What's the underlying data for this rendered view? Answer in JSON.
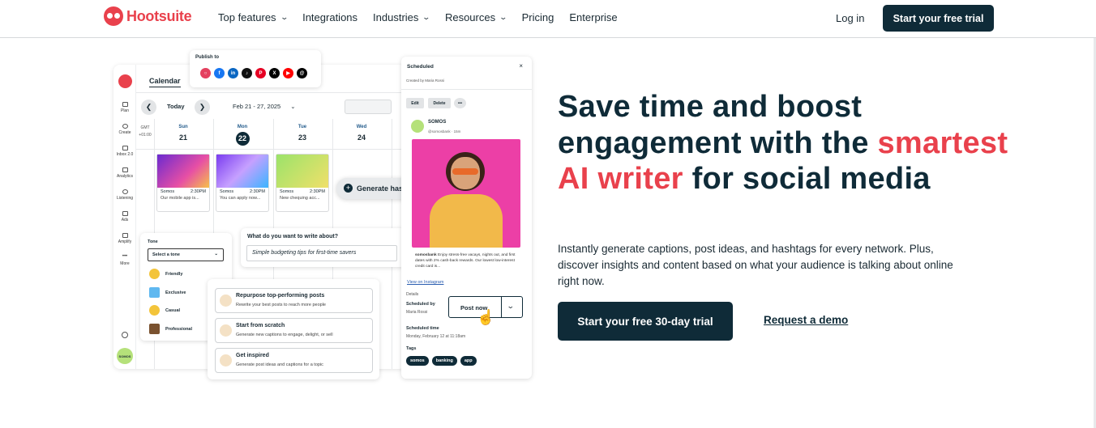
{
  "nav": {
    "logo_text": "Hootsuite",
    "items": [
      {
        "label": "Top features",
        "dropdown": true
      },
      {
        "label": "Integrations",
        "dropdown": false
      },
      {
        "label": "Industries",
        "dropdown": true
      },
      {
        "label": "Resources",
        "dropdown": true
      },
      {
        "label": "Pricing",
        "dropdown": false
      },
      {
        "label": "Enterprise",
        "dropdown": false
      }
    ],
    "login": "Log in",
    "cta": "Start your free trial"
  },
  "hero": {
    "headline_pre": "Save time and boost engagement with the ",
    "headline_highlight": "smartest AI writer",
    "headline_post": " for social media",
    "subtext": "Instantly generate captions, post ideas, and hashtags for every network. Plus, discover insights and content based on what your audience is talking about online right now.",
    "cta": "Start your free 30-day trial",
    "secondary": "Request a demo"
  },
  "mockup": {
    "calendar_title": "Calendar",
    "today": "Today",
    "date_range": "Feb 21 - 27, 2025",
    "tz": "GMT +01:00",
    "days": [
      {
        "name": "Sun",
        "num": "21"
      },
      {
        "name": "Mon",
        "num": "22"
      },
      {
        "name": "Tue",
        "num": "23"
      },
      {
        "name": "Wed",
        "num": "24"
      }
    ],
    "sidebar": [
      "Plan",
      "Create",
      "Inbox 2.0",
      "Analytics",
      "Listening",
      "Ads",
      "Amplify",
      "More"
    ],
    "avatar": "SOMOS",
    "posts": [
      {
        "account": "Somos",
        "time": "2:30PM",
        "text": "Our mobile app is..."
      },
      {
        "account": "Somos",
        "time": "2:30PM",
        "text": "You can apply now..."
      },
      {
        "account": "Somos",
        "time": "2:30PM",
        "text": "New chequing acc..."
      }
    ],
    "publish_to": "Publish to",
    "generate_hashtags": "Generate hashtags",
    "tone": {
      "label": "Tone",
      "placeholder": "Select a tone",
      "options": [
        "Friendly",
        "Exclusive",
        "Casual",
        "Professional"
      ]
    },
    "write": {
      "question": "What do you want to write about?",
      "value": "Simple budgeting tips for first-time savers"
    },
    "ai_options": [
      {
        "title": "Repurpose top-performing posts",
        "desc": "Rewrite your best posts to reach more people"
      },
      {
        "title": "Start from scratch",
        "desc": "Generate new captions to engage, delight, or sell"
      },
      {
        "title": "Get inspired",
        "desc": "Generate post ideas and captions for a topic"
      }
    ],
    "scheduled": {
      "title": "Scheduled",
      "created_by": "Created by Maria Rossi",
      "edit": "Edit",
      "delete": "Delete",
      "more": "•••",
      "account": "SOMOS",
      "handle": "@somosbank · 15m",
      "caption_handle": "somosbank",
      "caption": "Enjoy stress-free vacays, nights out, and first dates with 2% cash-back rewards. Our lowest low-interest credit card is...",
      "view_instagram": "View on Instagram",
      "details": "Details",
      "scheduled_by_label": "Scheduled by",
      "scheduled_by": "Maria Rossi",
      "post_now": "Post now",
      "scheduled_time_label": "Scheduled time",
      "scheduled_time": "Monday, February 12 at 11:18am",
      "tags_label": "Tags",
      "tags": [
        "somos",
        "banking",
        "app"
      ]
    }
  },
  "colors": {
    "brand_red": "#e9414c",
    "navy": "#0f2b38"
  }
}
